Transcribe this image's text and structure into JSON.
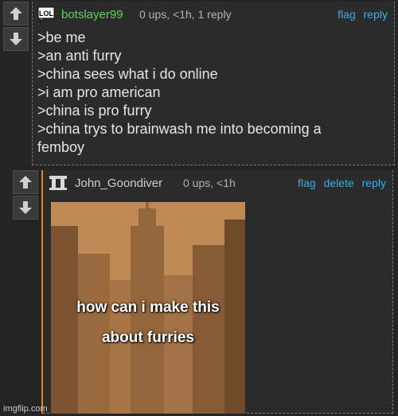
{
  "comments": [
    {
      "avatar_text": "LOL",
      "username": "botslayer99",
      "meta": "0 ups, <1h, 1 reply",
      "actions": [
        "flag",
        "reply"
      ],
      "lines": [
        ">be me",
        ">an anti furry",
        ">china sees what i do online",
        ">i am pro american",
        ">china is pro furry",
        ">china trys to brainwash me into becoming a",
        "femboy"
      ]
    },
    {
      "username": "John_Goondiver",
      "meta": "0 ups, <1h",
      "actions": [
        "flag",
        "delete",
        "reply"
      ],
      "meme": {
        "caption_line1": "how can i make this",
        "caption_line2": "about furries"
      }
    }
  ],
  "watermark": "imgflip.com",
  "colors": {
    "background": "#242424",
    "username_green": "#5ed35e",
    "action_blue": "#34aee6",
    "reply_bar_orange": "#e88420"
  }
}
